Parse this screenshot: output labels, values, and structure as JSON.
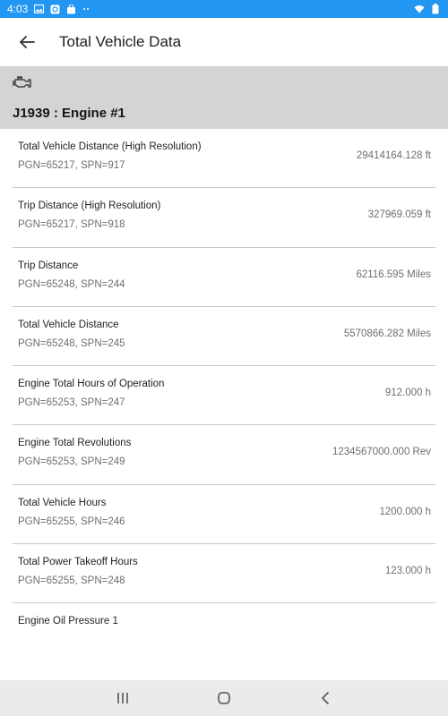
{
  "status_bar": {
    "time": "4:03",
    "icons_left": [
      "image-icon",
      "sync-icon",
      "bag-icon",
      "more-dots-icon"
    ],
    "icons_right": [
      "wifi-icon",
      "battery-icon"
    ]
  },
  "app_bar": {
    "title": "Total Vehicle Data"
  },
  "section": {
    "icon": "engine-icon",
    "title": "J1939 : Engine #1"
  },
  "items": [
    {
      "name": "Total Vehicle Distance (High Resolution)",
      "pgn": "PGN=65217, SPN=917",
      "value": "29414164.128 ft"
    },
    {
      "name": "Trip Distance (High Resolution)",
      "pgn": "PGN=65217, SPN=918",
      "value": "327969.059 ft"
    },
    {
      "name": "Trip Distance",
      "pgn": "PGN=65248, SPN=244",
      "value": "62116.595 Miles"
    },
    {
      "name": "Total Vehicle Distance",
      "pgn": "PGN=65248, SPN=245",
      "value": "5570866.282 Miles"
    },
    {
      "name": "Engine Total Hours of Operation",
      "pgn": "PGN=65253, SPN=247",
      "value": "912.000 h"
    },
    {
      "name": "Engine Total Revolutions",
      "pgn": "PGN=65253, SPN=249",
      "value": "1234567000.000 Rev"
    },
    {
      "name": "Total Vehicle Hours",
      "pgn": "PGN=65255, SPN=246",
      "value": "1200.000 h"
    },
    {
      "name": "Total Power Takeoff Hours",
      "pgn": "PGN=65255, SPN=248",
      "value": "123.000 h"
    },
    {
      "name": "Engine Oil Pressure 1",
      "pgn": "",
      "value": ""
    }
  ],
  "nav_bar": {
    "buttons": [
      "recents-icon",
      "home-icon",
      "back-icon"
    ]
  },
  "colors": {
    "status_bar": "#2196f3",
    "section_header": "#d4d4d4",
    "nav_bar": "#ebebeb"
  }
}
